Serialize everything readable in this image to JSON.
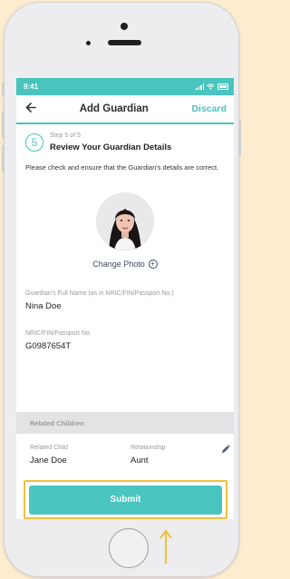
{
  "status_bar": {
    "time": "9:41"
  },
  "header": {
    "back_icon": "arrow-left-icon",
    "title": "Add Guardian",
    "discard_label": "Discard"
  },
  "step": {
    "number": "5",
    "progress_text": "Step 5 of 5",
    "title": "Review Your Guardian Details"
  },
  "description": "Please check and ensure that the Guardian's details are correct.",
  "photo": {
    "change_label": "Change Photo",
    "change_icon": "plus-circle-icon"
  },
  "guardian": {
    "name_label": "Guardian's Full Name (as in NRIC/FIN/Passport No.)",
    "name_value": "Nina Doe",
    "id_label": "NRIC/FIN/Passport No.",
    "id_value": "G0987654T"
  },
  "related_children": {
    "section_title": "Related Children",
    "child_label": "Related Child",
    "child_value": "Jane Doe",
    "relationship_label": "Relationship",
    "relationship_value": "Aunt",
    "edit_icon": "pencil-icon"
  },
  "submit_label": "Submit",
  "colors": {
    "accent": "#4ac4bf",
    "highlight": "#f0c13c",
    "page_background": "#fdeccf"
  }
}
